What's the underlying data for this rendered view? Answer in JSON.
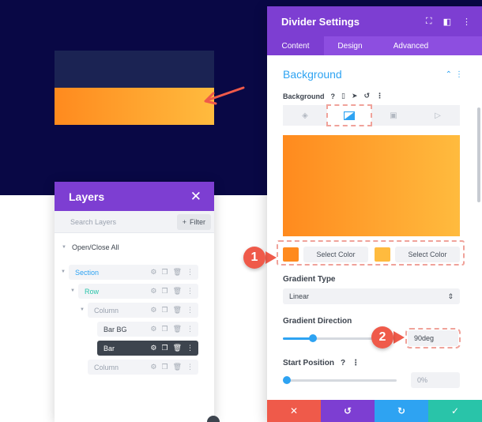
{
  "layers": {
    "title": "Layers",
    "close": "✕",
    "search_placeholder": "Search Layers",
    "filter_label": "Filter",
    "open_close": "Open/Close All",
    "items": [
      {
        "label": "Section",
        "color": "#2ea3f2"
      },
      {
        "label": "Row",
        "color": "#29c4a9"
      },
      {
        "label": "Column",
        "color": "#9aa2af"
      },
      {
        "label": "Bar BG",
        "color": "#3d444e"
      },
      {
        "label": "Bar",
        "color": "#ffffff",
        "selected": true
      },
      {
        "label": "Column",
        "color": "#9aa2af"
      }
    ]
  },
  "settings": {
    "title": "Divider Settings",
    "tabs": [
      "Content",
      "Design",
      "Advanced"
    ],
    "active_tab": "Content",
    "section": "Background",
    "background_label": "Background",
    "gradient_start_color": "#ff8a1e",
    "gradient_end_color": "#ffbb3e",
    "stop1_color": "#ff8a1e",
    "stop2_color": "#ffbb3e",
    "select_color_label": "Select Color",
    "gradient_type_label": "Gradient Type",
    "gradient_type_value": "Linear",
    "gradient_direction_label": "Gradient Direction",
    "gradient_direction_value": "90deg",
    "start_position_label": "Start Position",
    "start_position_value": "0%"
  },
  "callouts": [
    "1",
    "2"
  ],
  "colors": {
    "accent": "#7d3ed2",
    "link": "#2ea3f2",
    "cancel": "#ef5a4a",
    "undo": "#7d3ed2",
    "redo": "#2ea3f2",
    "save": "#29c4a9",
    "canvas": "#090845"
  }
}
